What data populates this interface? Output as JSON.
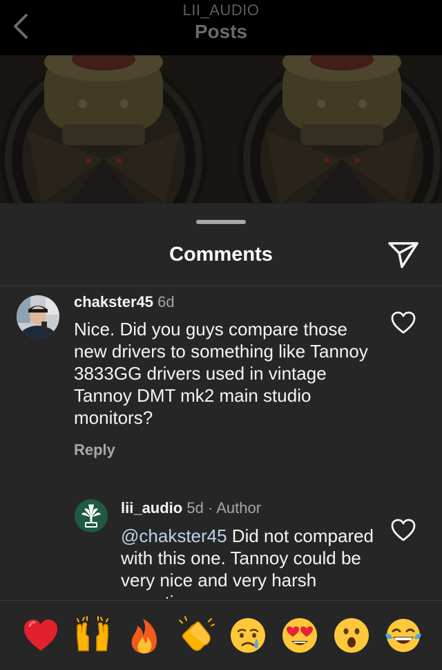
{
  "header": {
    "account": "LII_AUDIO",
    "title": "Posts"
  },
  "comments_sheet": {
    "title": "Comments",
    "comments": [
      {
        "username": "chakster45",
        "time": "6d",
        "text": "Nice. Did you guys compare those new drivers to something like Tannoy 3833GG drivers used in vintage Tannoy DMT mk2 main studio monitors?",
        "reply_label": "Reply"
      },
      {
        "username": "lii_audio",
        "time": "5d",
        "separator": "·",
        "badge": "Author",
        "mention": "@chakster45",
        "text": " Did not compared with this one. Tannoy could be very nice and very harsh sometimes"
      }
    ]
  },
  "emoji_bar": {
    "reactions": [
      "red-heart",
      "raising-hands",
      "fire",
      "clapping-hands",
      "crying-face",
      "heart-eyes",
      "surprised-face",
      "tears-of-joy"
    ]
  }
}
